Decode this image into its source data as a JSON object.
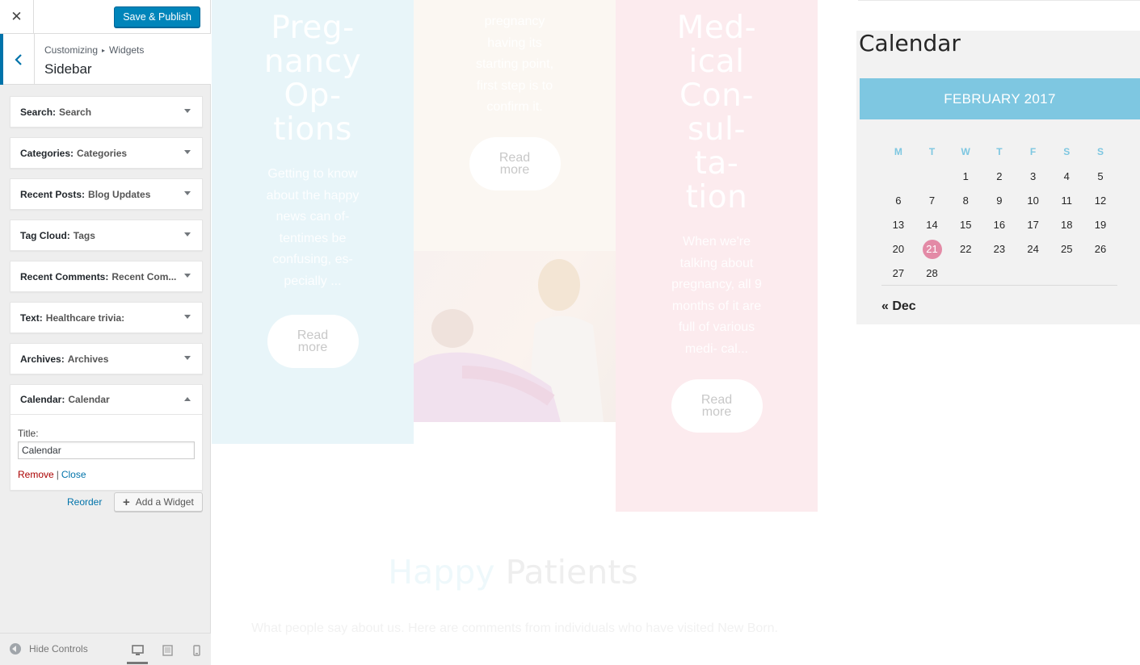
{
  "customizer": {
    "publish_label": "Save & Publish",
    "breadcrumb": {
      "parent": "Customizing",
      "current": "Widgets"
    },
    "section_title": "Sidebar",
    "widgets": [
      {
        "name": "Search:",
        "title": "Search"
      },
      {
        "name": "Categories:",
        "title": "Categories"
      },
      {
        "name": "Recent Posts:",
        "title": "Blog Updates"
      },
      {
        "name": "Tag Cloud:",
        "title": "Tags"
      },
      {
        "name": "Recent Comments:",
        "title": "Recent Com..."
      },
      {
        "name": "Text:",
        "title": "Healthcare trivia:"
      },
      {
        "name": "Archives:",
        "title": "Archives"
      },
      {
        "name": "Calendar:",
        "title": "Calendar"
      }
    ],
    "open_widget": {
      "field_label": "Title:",
      "field_value": "Calendar",
      "remove_label": "Remove",
      "separator": "|",
      "close_label": "Close"
    },
    "reorder_label": "Reorder",
    "add_widget_label": "Add a Widget",
    "hide_controls_label": "Hide Controls"
  },
  "preview": {
    "col1": {
      "title": "Preg-\nnancy\nOp-\ntions",
      "text": "Getting to know about the happy news can of- tentimes be confusing, es- pecially ...",
      "button": "Read more"
    },
    "col2": {
      "text": "pregnancy having its starting point, first step is to confirm it.",
      "button": "Read more"
    },
    "col3": {
      "title": "Med-\nical\nCon-\nsul-\nta-\ntion",
      "text": "When we're talking about pregnancy, all 9 months of it are full of various medi- cal...",
      "button": "Read more"
    },
    "happy": {
      "accent": "Happy",
      "rest": "Patients",
      "desc": "What people say about us. Here are comments from individuals who have visited New Born."
    },
    "calendar": {
      "heading": "Calendar",
      "month": "FEBRUARY 2017",
      "weekdays": [
        "M",
        "T",
        "W",
        "T",
        "F",
        "S",
        "S"
      ],
      "weeks": [
        [
          "",
          "",
          "1",
          "2",
          "3",
          "4",
          "5"
        ],
        [
          "6",
          "7",
          "8",
          "9",
          "10",
          "11",
          "12"
        ],
        [
          "13",
          "14",
          "15",
          "16",
          "17",
          "18",
          "19"
        ],
        [
          "20",
          "21",
          "22",
          "23",
          "24",
          "25",
          "26"
        ],
        [
          "27",
          "28",
          "",
          "",
          "",
          "",
          ""
        ]
      ],
      "today": "21",
      "prev_link": "« Dec"
    }
  },
  "colors": {
    "primary": "#0085ba",
    "calendar_header": "#7ec7e1",
    "today": "#e38aa6",
    "remove": "#aa0000"
  }
}
